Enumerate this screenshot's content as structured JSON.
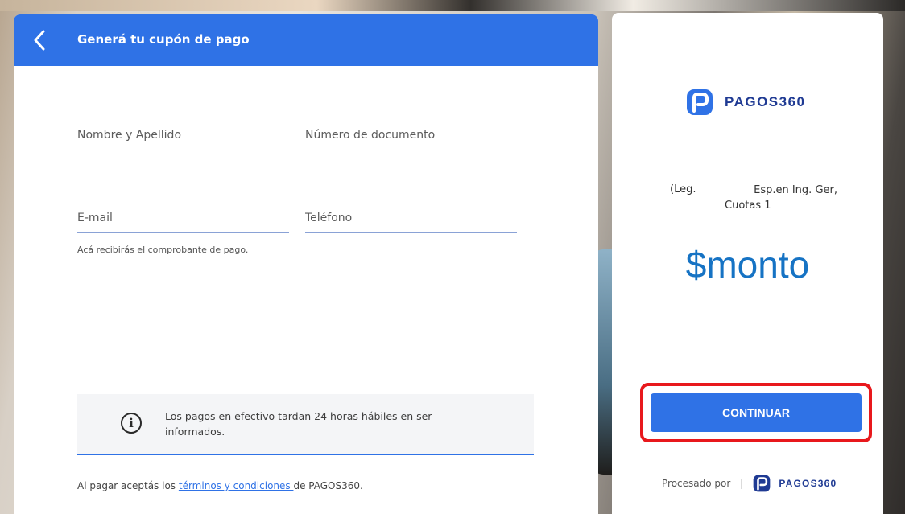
{
  "form": {
    "title": "Generá tu cupón de pago",
    "name_placeholder": "Nombre y Apellido",
    "document_placeholder": "Número de documento",
    "email_placeholder": "E-mail",
    "phone_placeholder": "Teléfono",
    "email_hint": "Acá recibirás el comprobante de pago.",
    "info_text": "Los pagos en efectivo tardan 24 horas hábiles en ser informados.",
    "terms_prefix": "Al pagar aceptás los ",
    "terms_link": "términos y condiciones ",
    "terms_suffix": "de PAGOS360."
  },
  "summary": {
    "brand": "PAGOS360",
    "desc_left": "(Leg.",
    "desc_right_line1": "Esp.en Ing. Ger,",
    "desc_right_line2": "Cuotas 1",
    "amount": "$monto",
    "continue_label": "CONTINUAR",
    "processed_by": "Procesado por",
    "separator": "|",
    "processed_brand": "PAGOS360"
  },
  "colors": {
    "primary": "#2f72e6",
    "brand_dark": "#1f3a93",
    "amount": "#1673c4",
    "highlight": "#e8181c"
  },
  "icons": {
    "back": "chevron-left-icon",
    "info": "info-circle-icon",
    "logo": "pagos360-logo-icon"
  }
}
